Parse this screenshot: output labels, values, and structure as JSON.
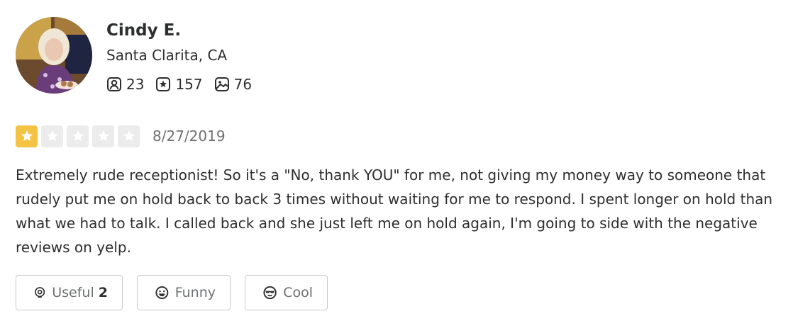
{
  "user": {
    "name": "Cindy E.",
    "location": "Santa Clarita, CA",
    "stats": {
      "friends": "23",
      "reviews": "157",
      "photos": "76"
    }
  },
  "review": {
    "rating": 1,
    "max_rating": 5,
    "date": "8/27/2019",
    "text": "Extremely rude receptionist! So it's a \"No, thank YOU\" for me, not giving my money way to someone that rudely put me on hold back to back 3 times without waiting for me to respond. I spent longer on hold than what we had to talk. I called back and she just left me on hold again, I'm going to side with the negative reviews on yelp."
  },
  "reactions": {
    "useful_label": "Useful",
    "useful_count": "2",
    "funny_label": "Funny",
    "cool_label": "Cool"
  },
  "colors": {
    "star_filled": "#f5c343",
    "star_empty": "#ececec",
    "text": "#2d2e2f",
    "muted": "#6e7072",
    "border": "#c8c9ca"
  }
}
